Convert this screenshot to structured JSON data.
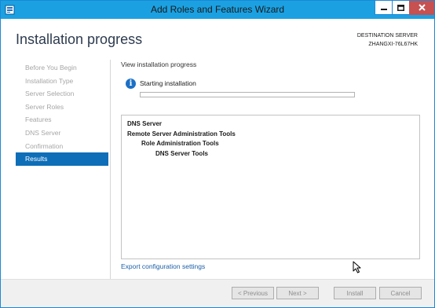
{
  "window": {
    "title": "Add Roles and Features Wizard"
  },
  "header": {
    "title": "Installation progress",
    "destination_label": "DESTINATION SERVER",
    "destination_server": "ZHANGXI-76L67HK"
  },
  "sidebar": {
    "items": [
      {
        "label": "Before You Begin",
        "active": false
      },
      {
        "label": "Installation Type",
        "active": false
      },
      {
        "label": "Server Selection",
        "active": false
      },
      {
        "label": "Server Roles",
        "active": false
      },
      {
        "label": "Features",
        "active": false
      },
      {
        "label": "DNS Server",
        "active": false
      },
      {
        "label": "Confirmation",
        "active": false
      },
      {
        "label": "Results",
        "active": true
      }
    ]
  },
  "main": {
    "view_label": "View installation progress",
    "status": "Starting installation",
    "progress_percent": 0,
    "results": [
      {
        "text": "DNS Server",
        "level": 0
      },
      {
        "text": "Remote Server Administration Tools",
        "level": 0
      },
      {
        "text": "Role Administration Tools",
        "level": 1
      },
      {
        "text": "DNS Server Tools",
        "level": 2
      }
    ],
    "export_link": "Export configuration settings"
  },
  "footer": {
    "previous_label": "< Previous",
    "next_label": "Next >",
    "install_label": "Install",
    "cancel_label": "Cancel"
  },
  "colors": {
    "titlebar": "#1ba1e2",
    "active_nav": "#0e6eb8",
    "link": "#1b5fa8",
    "info_icon": "#1b70c6"
  }
}
